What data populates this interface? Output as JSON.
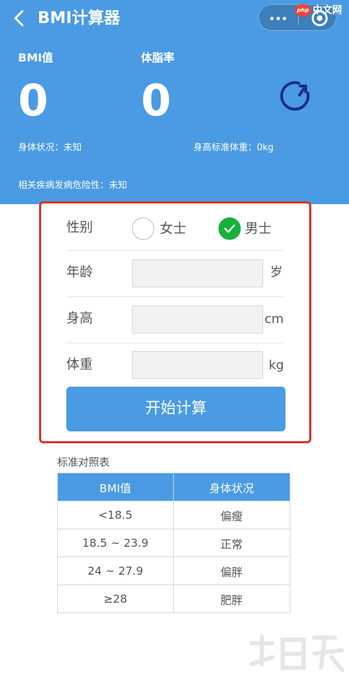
{
  "nav": {
    "title": "BMI计算器"
  },
  "watermark": {
    "logo": "php",
    "text": "中文网"
  },
  "stats": {
    "bmi_label": "BMI值",
    "bmi_value": "0",
    "fat_label": "体脂率",
    "fat_value": "0"
  },
  "info": {
    "body_status": "身体状况：未知",
    "standard_weight": "身高标准体重：0kg",
    "disease_risk": "相关疾病发病危险性：未知"
  },
  "form": {
    "gender_label": "性别",
    "female_label": "女士",
    "male_label": "男士",
    "selected_gender": "男士",
    "age_label": "年龄",
    "age_value": "",
    "age_unit": "岁",
    "height_label": "身高",
    "height_value": "",
    "height_unit": "cm",
    "weight_label": "体重",
    "weight_value": "",
    "weight_unit": "kg",
    "submit_label": "开始计算"
  },
  "table": {
    "caption": "标准对照表",
    "headers": [
      "BMI值",
      "身体状况"
    ],
    "rows": [
      [
        "<18.5",
        "偏瘦"
      ],
      [
        "18.5 ~ 23.9",
        "正常"
      ],
      [
        "24 ~ 27.9",
        "偏胖"
      ],
      [
        "≥28",
        "肥胖"
      ]
    ]
  },
  "colors": {
    "primary": "#4a9be3",
    "highlight_border": "#d9322c",
    "checked": "#17b23a",
    "refresh_icon": "#1b2a8c"
  },
  "icons": [
    "back-icon",
    "more-dots-icon",
    "target-icon",
    "refresh-icon",
    "checkmark-icon"
  ]
}
